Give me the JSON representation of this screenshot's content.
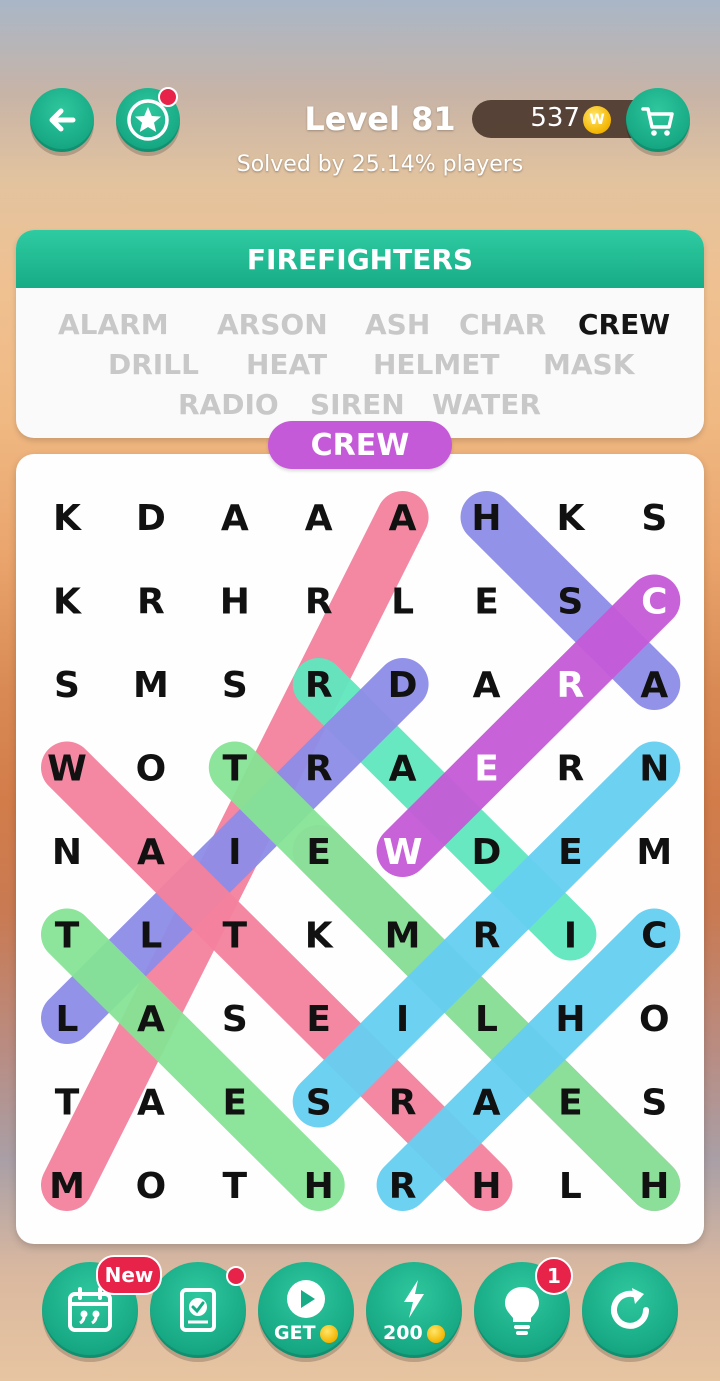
{
  "header": {
    "level_title": "Level 81",
    "solved_text": "Solved by 25.14% players",
    "coins": "537",
    "coin_symbol": "W"
  },
  "topic": "FIREFIGHTERS",
  "words": [
    {
      "text": "ALARM",
      "found": false
    },
    {
      "text": "ARSON",
      "found": false
    },
    {
      "text": "ASH",
      "found": false
    },
    {
      "text": "CHAR",
      "found": false
    },
    {
      "text": "CREW",
      "found": true
    },
    {
      "text": "DRILL",
      "found": false
    },
    {
      "text": "HEAT",
      "found": false
    },
    {
      "text": "HELMET",
      "found": false
    },
    {
      "text": "MASK",
      "found": false
    },
    {
      "text": "RADIO",
      "found": false
    },
    {
      "text": "SIREN",
      "found": false
    },
    {
      "text": "WATER",
      "found": false
    }
  ],
  "current_word": "CREW",
  "grid": [
    [
      "K",
      "D",
      "A",
      "A",
      "A",
      "H",
      "K",
      "S"
    ],
    [
      "K",
      "R",
      "H",
      "R",
      "L",
      "E",
      "S",
      "C"
    ],
    [
      "S",
      "M",
      "S",
      "R",
      "D",
      "A",
      "R",
      "A"
    ],
    [
      "W",
      "O",
      "T",
      "R",
      "A",
      "E",
      "R",
      "N"
    ],
    [
      "N",
      "A",
      "I",
      "E",
      "W",
      "D",
      "E",
      "M"
    ],
    [
      "T",
      "L",
      "T",
      "K",
      "M",
      "R",
      "I",
      "C"
    ],
    [
      "L",
      "A",
      "S",
      "E",
      "I",
      "L",
      "H",
      "O"
    ],
    [
      "T",
      "A",
      "E",
      "S",
      "R",
      "A",
      "E",
      "S"
    ],
    [
      "M",
      "O",
      "T",
      "H",
      "R",
      "H",
      "L",
      "H"
    ]
  ],
  "bottom_bar": {
    "new_badge": "New",
    "watch_label": "GET",
    "boost_label": "200",
    "hint_count": "1"
  },
  "colors": {
    "brand_green": "#1bb38c",
    "purple": "#c55ad8",
    "badge_red": "#e8234a"
  }
}
